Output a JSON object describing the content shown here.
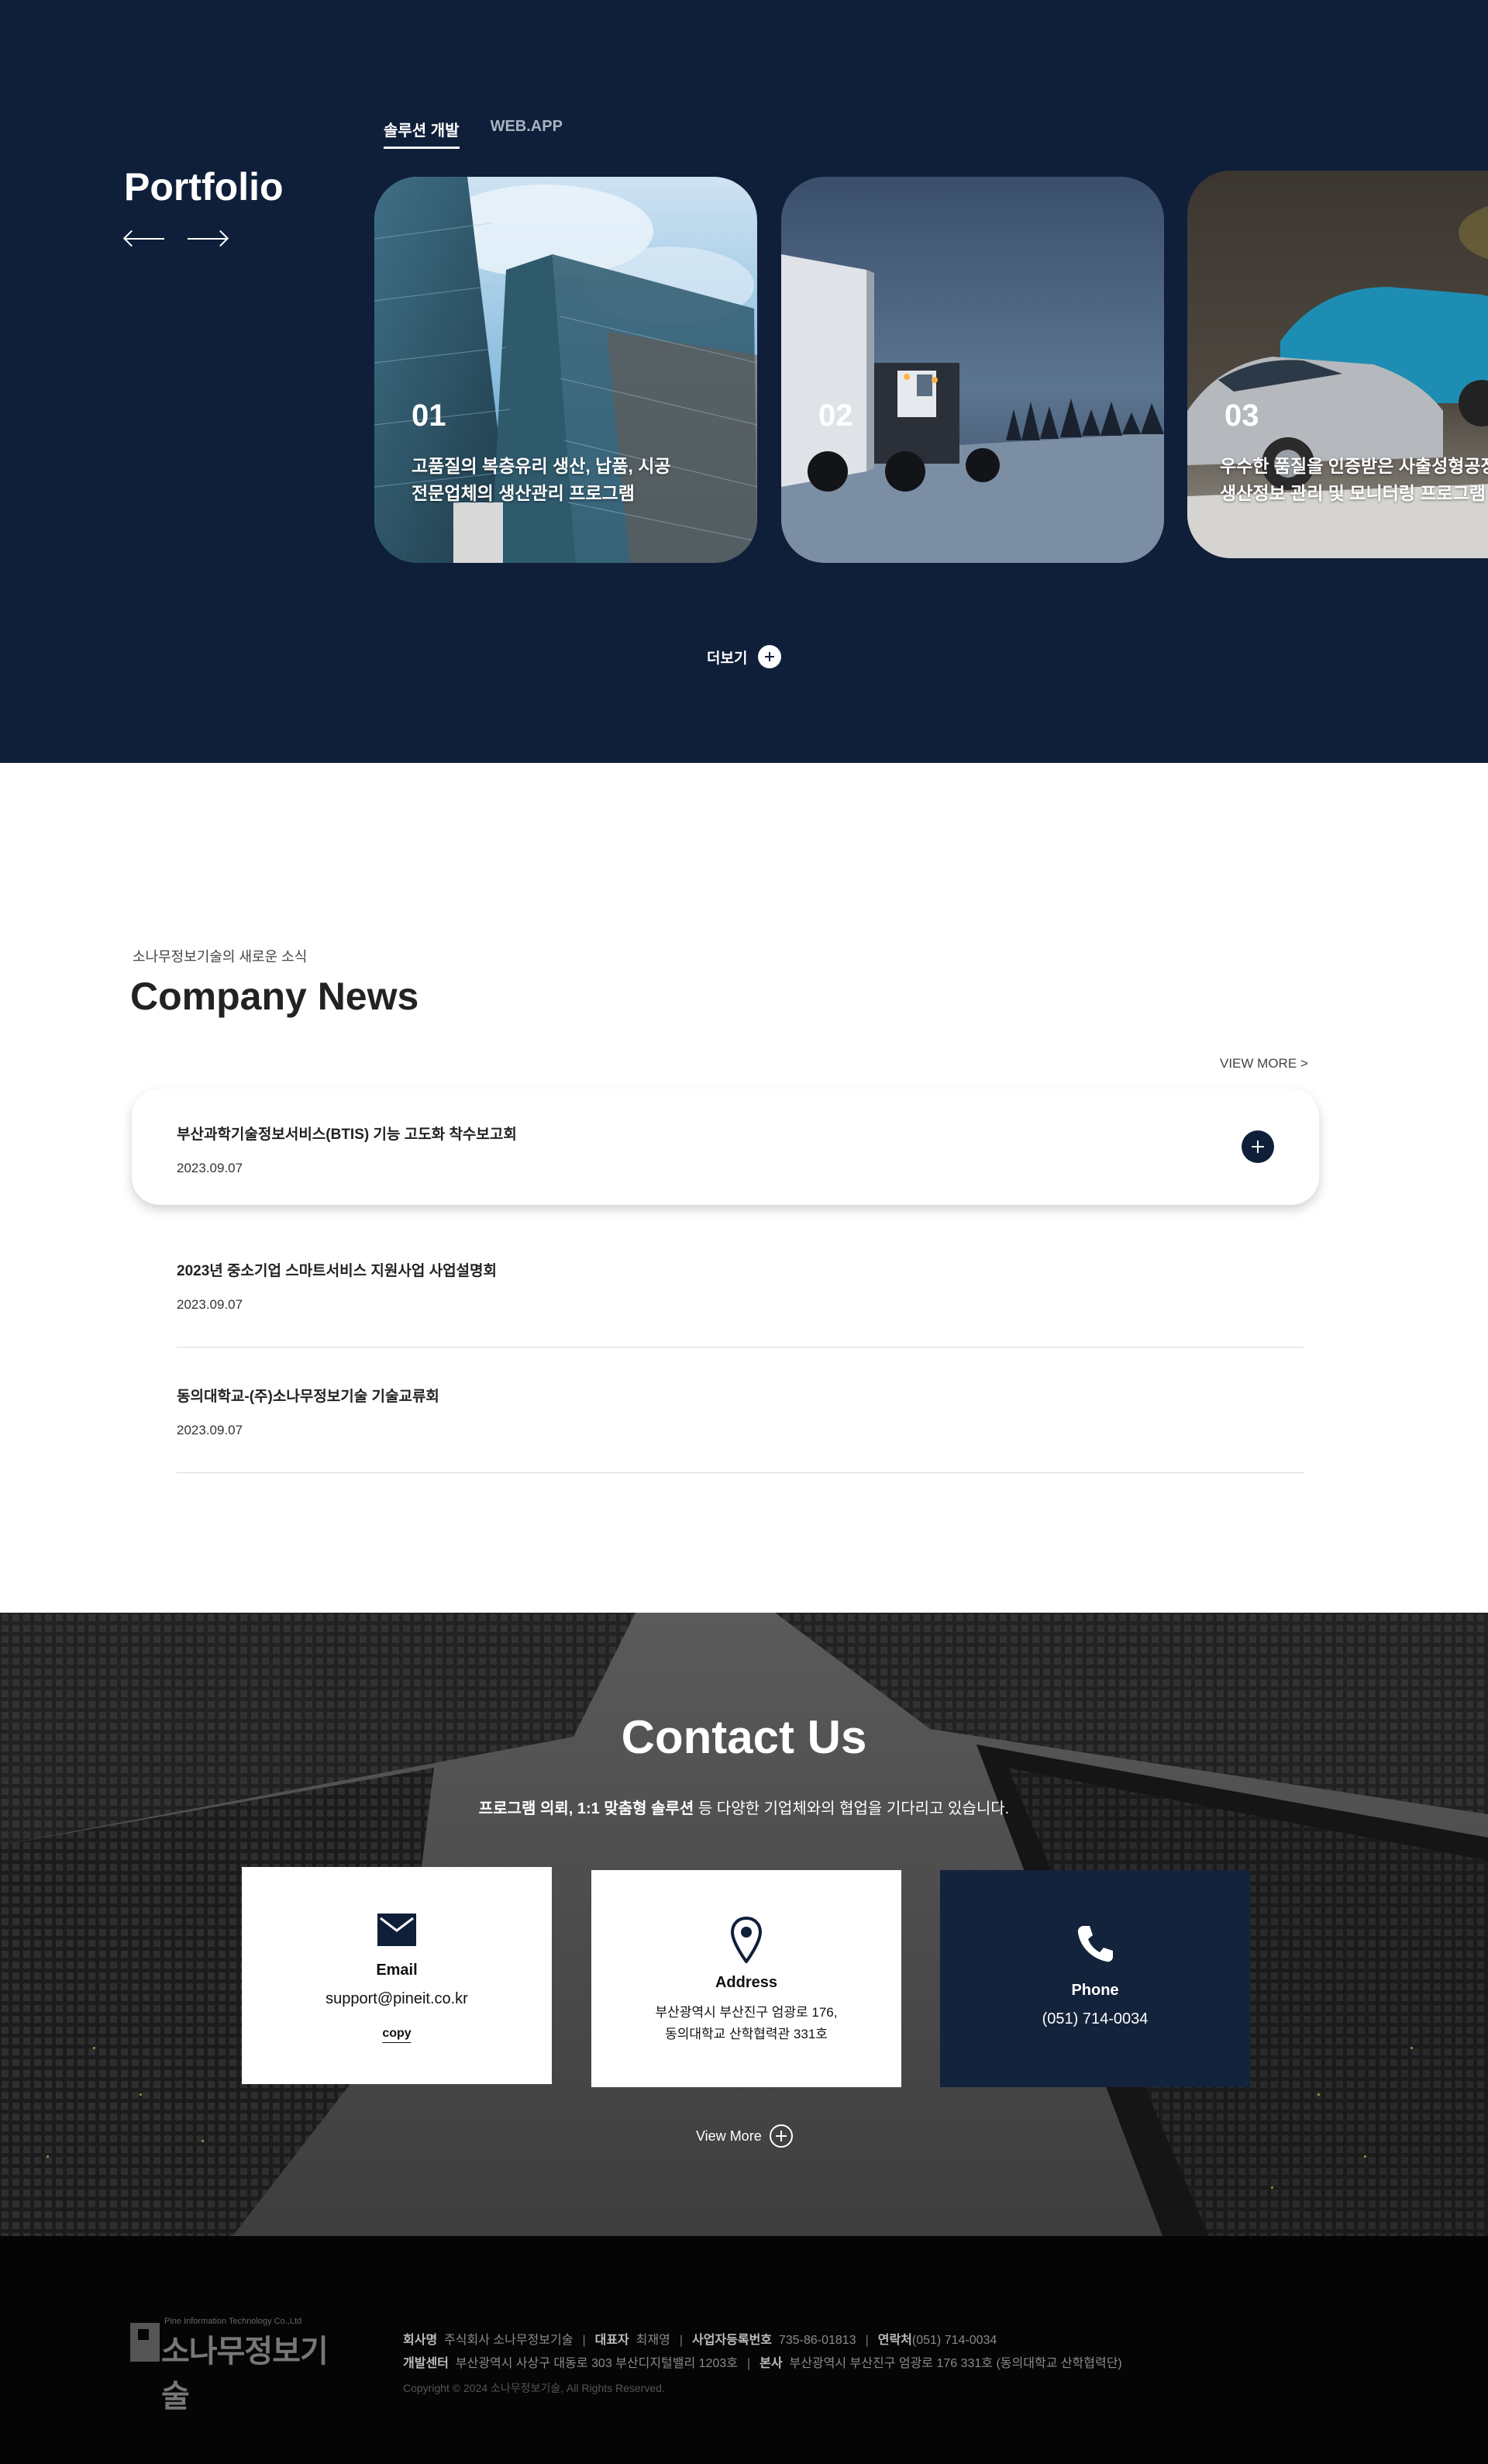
{
  "portfolio": {
    "title": "Portfolio",
    "tabs": [
      "솔루션 개발",
      "WEB.APP"
    ],
    "cards": [
      {
        "num": "01",
        "line1": "고품질의 복층유리 생산, 납품, 시공",
        "line2": "전문업체의 생산관리 프로그램"
      },
      {
        "num": "02",
        "line1": "",
        "line2": ""
      },
      {
        "num": "03",
        "line1": "우수한 품질을 인증받은 사출성형공장",
        "line2": "생산정보 관리 및 모니터링 프로그램"
      }
    ],
    "more_label": "더보기"
  },
  "news": {
    "subtitle": "소나무정보기술의 새로운 소식",
    "title": "Company News",
    "view_more": "VIEW MORE >",
    "items": [
      {
        "title": "부산과학기술정보서비스(BTIS) 기능 고도화 착수보고회",
        "date": "2023.09.07"
      },
      {
        "title": "2023년 중소기업 스마트서비스 지원사업 사업설명회",
        "date": "2023.09.07"
      },
      {
        "title": "동의대학교-(주)소나무정보기술 기술교류회",
        "date": "2023.09.07"
      }
    ]
  },
  "contact": {
    "title": "Contact Us",
    "sub_bold": "프로그램 의뢰, 1:1 맞춤형 솔루션",
    "sub_rest": " 등 다양한 기업체와의 협업을 기다리고 있습니다.",
    "email": {
      "label": "Email",
      "value": "support@pineit.co.kr",
      "copy": "copy"
    },
    "address": {
      "label": "Address",
      "line1": "부산광역시 부산진구 엄광로 176,",
      "line2": "동의대학교 산학협력관 331호"
    },
    "phone": {
      "label": "Phone",
      "value": "(051) 714-0034"
    },
    "view_more": "View More"
  },
  "footer": {
    "logo_tag": "Pine Information Technology Co.,Ltd",
    "logo_text": "소나무정보기술",
    "company_label": "회사명",
    "company": "주식회사 소나무정보기술",
    "ceo_label": "대표자",
    "ceo": "최재영",
    "bizno_label": "사업자등록번호",
    "bizno": "735-86-01813",
    "contact_label": "연락처",
    "contact": "(051) 714-0034",
    "devcenter_label": "개발센터",
    "devcenter": "부산광역시 사상구 대동로 303 부산디지털밸리 1203호",
    "hq_label": "본사",
    "hq": "부산광역시 부산진구 엄광로 176 331호 (동의대학교 산학협력단)",
    "copyright": "Copyright © 2024 소나무정보기술, All Rights Reserved."
  },
  "colors": {
    "navy": "#0f1f3a",
    "phone_card": "#13233b",
    "footer_bg": "#050505"
  }
}
